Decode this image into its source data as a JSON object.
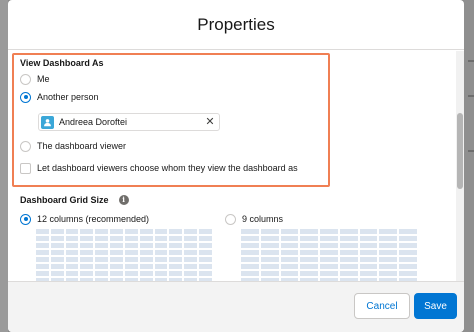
{
  "modal": {
    "title": "Properties"
  },
  "view_as": {
    "title": "View Dashboard As",
    "options": [
      {
        "label": "Me",
        "checked": false
      },
      {
        "label": "Another person",
        "checked": true
      },
      {
        "label": "The dashboard viewer",
        "checked": false
      }
    ],
    "selected_person": "Andreea Doroftei",
    "let_viewers_label": "Let dashboard viewers choose whom they view the dashboard as",
    "let_viewers_checked": false
  },
  "grid_size": {
    "title": "Dashboard Grid Size",
    "options": [
      {
        "label": "12 columns (recommended)",
        "checked": true,
        "columns": 12
      },
      {
        "label": "9 columns",
        "checked": false,
        "columns": 9
      }
    ]
  },
  "footer": {
    "cancel_label": "Cancel",
    "save_label": "Save"
  },
  "colors": {
    "accent": "#0176d3",
    "highlight_border": "#f07f53",
    "avatar": "#3ba7d8"
  },
  "icons": {
    "avatar": "user-icon",
    "remove": "close-icon",
    "info": "info-icon"
  }
}
